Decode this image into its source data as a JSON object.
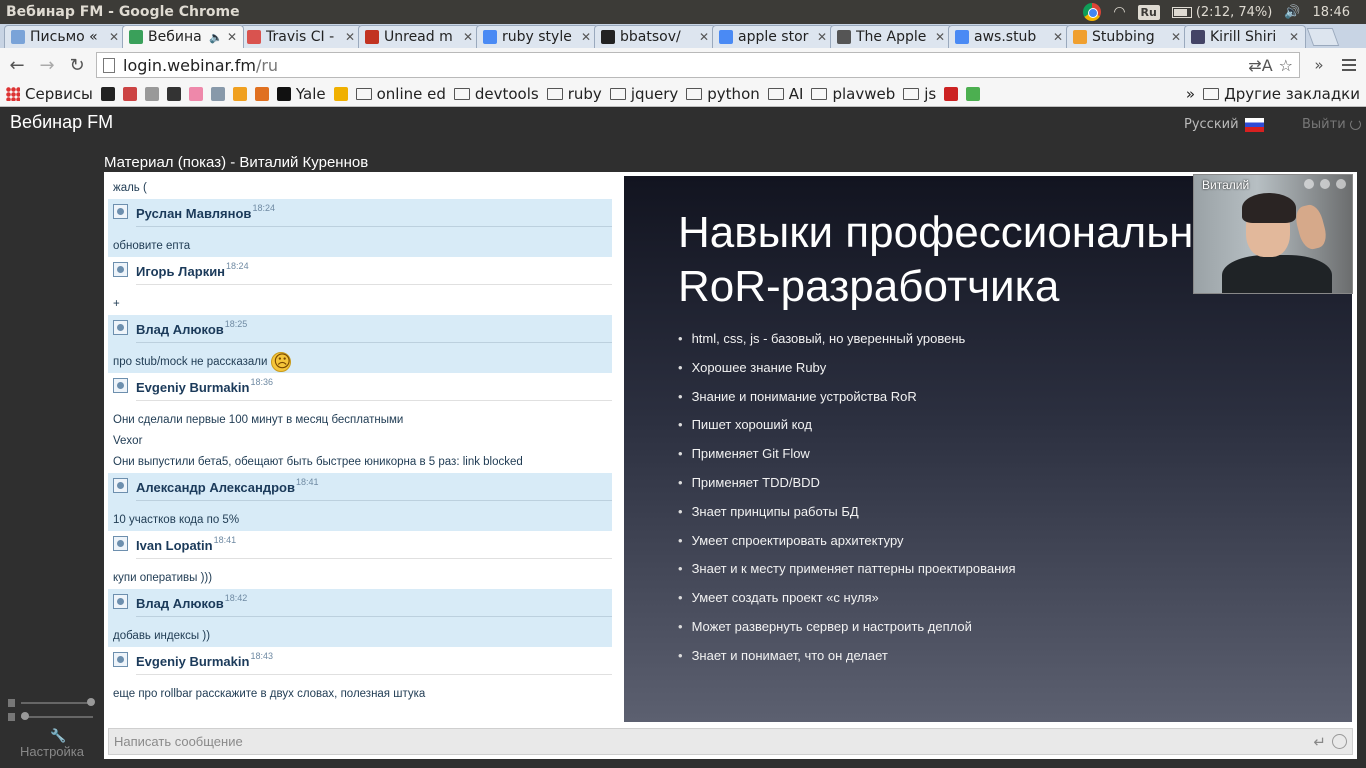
{
  "os": {
    "window_title": "Вебинар FM - Google Chrome",
    "keyboard_layout": "Ru",
    "battery": "(2:12, 74%)",
    "clock": "18:46"
  },
  "tabs": [
    {
      "label": "Письмо «",
      "icon": "mail-envelope-icon",
      "color": "#7aa3d8",
      "active": false
    },
    {
      "label": "Вебина",
      "icon": "webinar-icon",
      "color": "#3aa05a",
      "active": true,
      "audio": "🔈"
    },
    {
      "label": "Travis CI -",
      "icon": "travis-icon",
      "color": "#d9534f",
      "active": false
    },
    {
      "label": "Unread m",
      "icon": "gmail-icon",
      "color": "#c23321",
      "active": false
    },
    {
      "label": "ruby style",
      "icon": "google-icon",
      "color": "#4a8af4",
      "active": false
    },
    {
      "label": "bbatsov/",
      "icon": "github-icon",
      "color": "#222222",
      "active": false
    },
    {
      "label": "apple stor",
      "icon": "google-icon",
      "color": "#4a8af4",
      "active": false
    },
    {
      "label": "The Apple",
      "icon": "apple-icon",
      "color": "#555555",
      "active": false
    },
    {
      "label": "aws.stub",
      "icon": "google-icon",
      "color": "#4a8af4",
      "active": false
    },
    {
      "label": "Stubbing",
      "icon": "amazon-icon",
      "color": "#f0a030",
      "active": false
    },
    {
      "label": "Kirill Shiri",
      "icon": "blog-icon",
      "color": "#444466",
      "active": false
    }
  ],
  "toolbar": {
    "back": "←",
    "forward": "→",
    "reload": "↻",
    "url_host": "login.webinar.fm",
    "url_path": "/ru",
    "translate": "⇄A",
    "star": "☆",
    "extensions": "»"
  },
  "bookmarks": {
    "apps_label": "Сервисы",
    "items": [
      {
        "label": "",
        "icon": "github-icon"
      },
      {
        "label": "",
        "icon": "pinwheel-icon"
      },
      {
        "label": "",
        "icon": "gd-icon"
      },
      {
        "label": "",
        "icon": "calendar-icon"
      },
      {
        "label": "",
        "icon": "ring-icon"
      },
      {
        "label": "",
        "icon": "h-icon"
      },
      {
        "label": "",
        "icon": "cube-icon"
      },
      {
        "label": "",
        "icon": "stack-icon"
      },
      {
        "label": "Yale",
        "icon": "y-icon"
      },
      {
        "label": "",
        "icon": "n-icon"
      },
      {
        "label": "online ed",
        "icon": "folder-icon"
      },
      {
        "label": "devtools",
        "icon": "folder-icon"
      },
      {
        "label": "ruby",
        "icon": "folder-icon"
      },
      {
        "label": "jquery",
        "icon": "folder-icon"
      },
      {
        "label": "python",
        "icon": "folder-icon"
      },
      {
        "label": "AI",
        "icon": "folder-icon"
      },
      {
        "label": "plavweb",
        "icon": "folder-icon"
      },
      {
        "label": "js",
        "icon": "folder-icon"
      },
      {
        "label": "",
        "icon": "red-square-icon"
      },
      {
        "label": "",
        "icon": "green-drive-icon"
      }
    ],
    "overflow": "»",
    "other_label": "Другие закладки"
  },
  "app": {
    "brand": "Вебинар FM",
    "language": "Русский",
    "logout": "Выйти",
    "material_title": "Материал (показ) - Виталий Куреннов",
    "settings_label": "Настройка",
    "input_placeholder": "Написать сообщение",
    "enter_symbol": "↵"
  },
  "chat": [
    {
      "type": "text",
      "text": "жаль (",
      "hl": false
    },
    {
      "type": "message",
      "user": "Руслан Мавлянов",
      "time": "18:24",
      "text": "обновите епта",
      "hl": true
    },
    {
      "type": "message",
      "user": "Игорь Ларкин",
      "time": "18:24",
      "text": "+",
      "hl": false
    },
    {
      "type": "message",
      "user": "Влад Алюков",
      "time": "18:25",
      "text": "про stub/mock не рассказали",
      "smiley": true,
      "hl": true
    },
    {
      "type": "message",
      "user": "Evgeniy Burmakin",
      "time": "18:36",
      "text": "Они сделали первые 100 минут в месяц бесплатными",
      "hl": false
    },
    {
      "type": "text",
      "text": "Vexor",
      "hl": false
    },
    {
      "type": "text",
      "text": "Они выпустили бета5, обещают быть быстрее юникорна в 5 раз: link blocked",
      "hl": false
    },
    {
      "type": "message",
      "user": "Александр Александров",
      "time": "18:41",
      "text": "10 участков кода по 5%",
      "hl": true
    },
    {
      "type": "message",
      "user": "Ivan Lopatin",
      "time": "18:41",
      "text": "купи оперативы )))",
      "hl": false
    },
    {
      "type": "message",
      "user": "Влад Алюков",
      "time": "18:42",
      "text": "добавь индексы ))",
      "hl": true
    },
    {
      "type": "message",
      "user": "Evgeniy Burmakin",
      "time": "18:43",
      "text": "еще про rollbar расскажите в двух словах, полезная штука",
      "hl": false
    }
  ],
  "slide": {
    "title_line1": "Навыки профессионального",
    "title_line2": "RoR-разработчика",
    "bullets": [
      "html, css, js - базовый, но уверенный уровень",
      "Хорошее знание Ruby",
      "Знание и понимание устройства RoR",
      "Пишет хороший код",
      "Применяет Git Flow",
      "Применяет TDD/BDD",
      "Знает принципы работы БД",
      "Умеет спроектировать архитектуру",
      "Знает и к месту применяет паттерны проектирования",
      "Умеет создать проект «с нуля»",
      "Может развернуть сервер и настроить деплой",
      "Знает и понимает, что он делает"
    ]
  },
  "video": {
    "name": "Виталий"
  }
}
